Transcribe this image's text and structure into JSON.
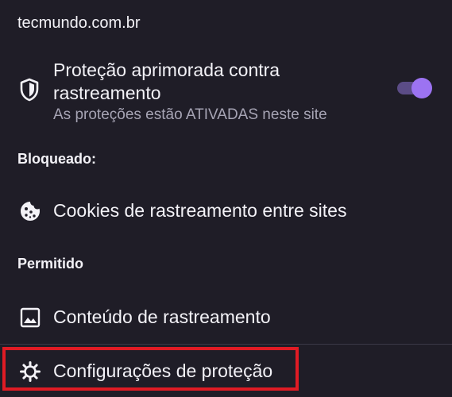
{
  "site": {
    "domain": "tecmundo.com.br"
  },
  "protection": {
    "icon": "shield-icon",
    "title": "Proteção aprimorada contra rastreamento",
    "status": "As proteções estão ATIVADAS neste site",
    "enabled": true,
    "accent_color": "#9c73f2"
  },
  "blocked": {
    "label": "Bloqueado:",
    "items": [
      {
        "icon": "cookie-icon",
        "label": "Cookies de rastreamento entre sites"
      }
    ]
  },
  "allowed": {
    "label": "Permitido",
    "items": [
      {
        "icon": "image-icon",
        "label": "Conteúdo de rastreamento"
      }
    ]
  },
  "settings": {
    "icon": "gear-icon",
    "label": "Configurações de proteção",
    "highlight_color": "#e01b24"
  }
}
